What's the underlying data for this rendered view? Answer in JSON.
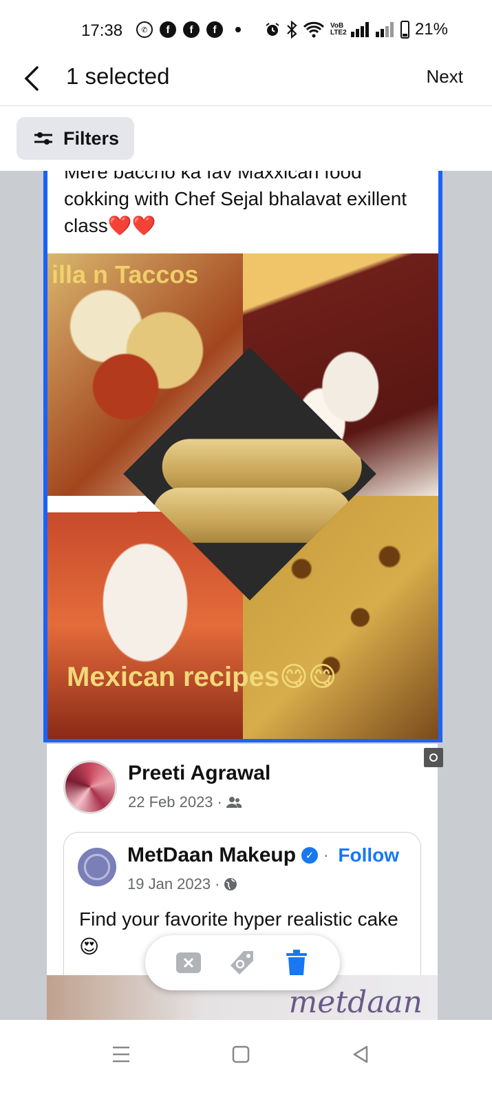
{
  "status_bar": {
    "time": "17:38",
    "notif_icons": [
      "whatsapp-icon",
      "facebook-icon",
      "facebook-icon",
      "facebook-icon"
    ],
    "battery": "21%",
    "volte_label": "VoB LTE2"
  },
  "header": {
    "title": "1 selected",
    "next_label": "Next"
  },
  "filters": {
    "label": "Filters"
  },
  "selected_post": {
    "text": "Mere baccho ka fav Maxxican food cokking with Chef Sejal bhalavat exillent class❤️❤️",
    "overlay_top": "illa n Taccos",
    "overlay_bottom": "Mexican recipes😋😋"
  },
  "post2": {
    "author": "Preeti Agrawal",
    "date": "22 Feb 2023",
    "shared": {
      "page_name": "MetDaan Makeup",
      "follow_label": "Follow",
      "date": "19 Jan 2023",
      "text": "Find your favorite hyper realistic cake 😍",
      "watermark": "metdaan"
    }
  },
  "colors": {
    "accent": "#1877f2",
    "selection_border": "#1b63f5",
    "feed_background": "#c9ccd1"
  }
}
